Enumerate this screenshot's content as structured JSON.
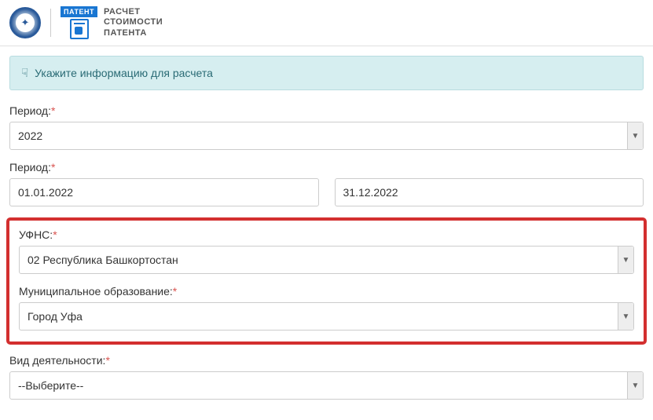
{
  "header": {
    "patent_badge": "ПАТЕНТ",
    "title_line1": "РАСЧЕТ",
    "title_line2": "СТОИМОСТИ",
    "title_line3": "ПАТЕНТА"
  },
  "banner": {
    "text": "Укажите информацию для расчета"
  },
  "fields": {
    "period_year": {
      "label": "Период:",
      "value": "2022"
    },
    "period_dates": {
      "label": "Период:",
      "from": "01.01.2022",
      "to": "31.12.2022"
    },
    "ufns": {
      "label": "УФНС:",
      "value": "02 Республика Башкортостан"
    },
    "municipality": {
      "label": "Муниципальное образование:",
      "value": "Город Уфа"
    },
    "activity": {
      "label": "Вид деятельности:",
      "value": "--Выберите--"
    }
  },
  "required_marker": "*"
}
